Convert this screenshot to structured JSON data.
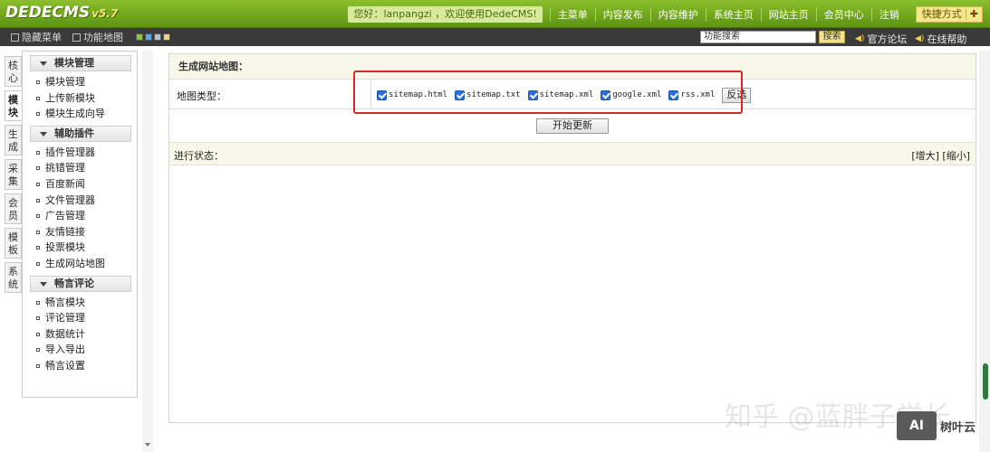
{
  "header": {
    "logo": "DEDECMS",
    "version": "v5.7",
    "greeting": "您好：lanpangzi ，欢迎使用DedeCMS!",
    "nav": [
      "主菜单",
      "内容发布",
      "内容维护",
      "系统主页",
      "网站主页",
      "会员中心",
      "注销"
    ],
    "quick": "快捷方式"
  },
  "subbar": {
    "hide_menu": "隐藏菜单",
    "func_map": "功能地图",
    "search_value": "功能搜索",
    "search_button": "搜索",
    "forum": "官方论坛",
    "help": "在线帮助"
  },
  "vtabs": [
    "核心",
    "模块",
    "生成",
    "采集",
    "会员",
    "模板",
    "系统"
  ],
  "leftmenu": {
    "groups": [
      {
        "title": "模块管理",
        "items": [
          "模块管理",
          "上传新模块",
          "模块生成向导"
        ]
      },
      {
        "title": "辅助插件",
        "items": [
          "插件管理器",
          "挑错管理",
          "百度新闻",
          "文件管理器",
          "广告管理",
          "友情链接",
          "投票模块",
          "生成网站地图"
        ]
      },
      {
        "title": "畅言评论",
        "items": [
          "畅言模块",
          "评论管理",
          "数据统计",
          "导入导出",
          "畅言设置"
        ]
      }
    ]
  },
  "main": {
    "title": "生成网站地图：",
    "map_type_label": "地图类型：",
    "options": [
      "sitemap.html",
      "sitemap.txt",
      "sitemap.xml",
      "google.xml",
      "rss.xml"
    ],
    "invert_label": "反选",
    "start_label": "开始更新",
    "status_label": "进行状态：",
    "zoom_label": "[增大] [缩小]"
  },
  "watermark": {
    "text": "知乎 @蓝胖子学长",
    "corner_box": "AI",
    "corner_text": "树叶云"
  },
  "colors": {
    "header_green": "#6fa51a",
    "highlight_red": "#d32828",
    "panel_bg": "#f8f8e8"
  }
}
